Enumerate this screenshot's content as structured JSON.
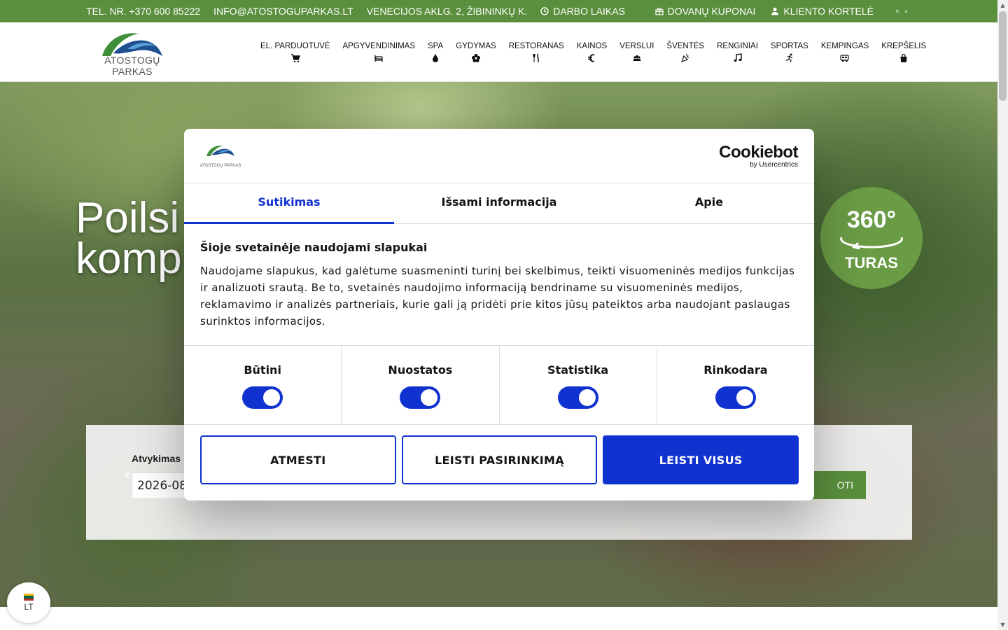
{
  "topbar": {
    "phone": "TEL. NR. +370 600 85222",
    "email": "INFO@ATOSTOGUPARKAS.LT",
    "address": "VENECIJOS AKLG. 2, ŽIBININKŲ K.",
    "hours": "DARBO LAIKAS",
    "gift": "DOVANŲ KUPONAI",
    "client": "KLIENTO KORTELĖ"
  },
  "header": {
    "logo_text": "ATOSTOGŲ PARKAS",
    "nav": [
      {
        "label": "EL. PARDUOTUVĖ",
        "icon": "cart-icon"
      },
      {
        "label": "APGYVENDINIMAS",
        "icon": "bed-icon"
      },
      {
        "label": "SPA",
        "icon": "drop-icon"
      },
      {
        "label": "GYDYMAS",
        "icon": "flower-icon"
      },
      {
        "label": "RESTORANAS",
        "icon": "fork-knife-icon"
      },
      {
        "label": "KAINOS",
        "icon": "euro-icon"
      },
      {
        "label": "VERSLUI",
        "icon": "group-icon"
      },
      {
        "label": "ŠVENTĖS",
        "icon": "party-icon"
      },
      {
        "label": "RENGINIAI",
        "icon": "music-icon"
      },
      {
        "label": "SPORTAS",
        "icon": "runner-icon"
      },
      {
        "label": "KEMPINGAS",
        "icon": "camper-icon"
      },
      {
        "label": "KREPŠELIS",
        "icon": "bag-icon"
      }
    ]
  },
  "hero": {
    "title_line1": "Poilsi",
    "title_line2": "komp",
    "tour_number": "360°",
    "tour_label": "TURAS",
    "booking_label": "Atvykimas",
    "booking_value": "2026-08",
    "booking_button": "OTI"
  },
  "lang": {
    "code": "LT"
  },
  "cookie": {
    "brand": "Cookiebot",
    "brand_by": "by Usercentrics",
    "logo_text": "ATOSTOGŲ PARKAS",
    "tabs": [
      "Sutikimas",
      "Išsami informacija",
      "Apie"
    ],
    "heading": "Šioje svetainėje naudojami slapukai",
    "body": "Naudojame slapukus, kad galėtume suasmeninti turinį bei skelbimus, teikti visuomeninės medijos funkcijas ir analizuoti srautą. Be to, svetainės naudojimo informaciją bendriname su visuomeninės medijos, reklamavimo ir analizės partneriais, kurie gali ją pridėti prie kitos jūsų pateiktos arba naudojant paslaugas surinktos informacijos.",
    "toggles": [
      "Būtini",
      "Nuostatos",
      "Statistika",
      "Rinkodara"
    ],
    "buttons": {
      "reject": "ATMESTI",
      "selection": "LEISTI PASIRINKIMĄ",
      "all": "LEISTI VISUS"
    }
  },
  "colors": {
    "green": "#5a8f3d",
    "blue": "#1032cf"
  }
}
